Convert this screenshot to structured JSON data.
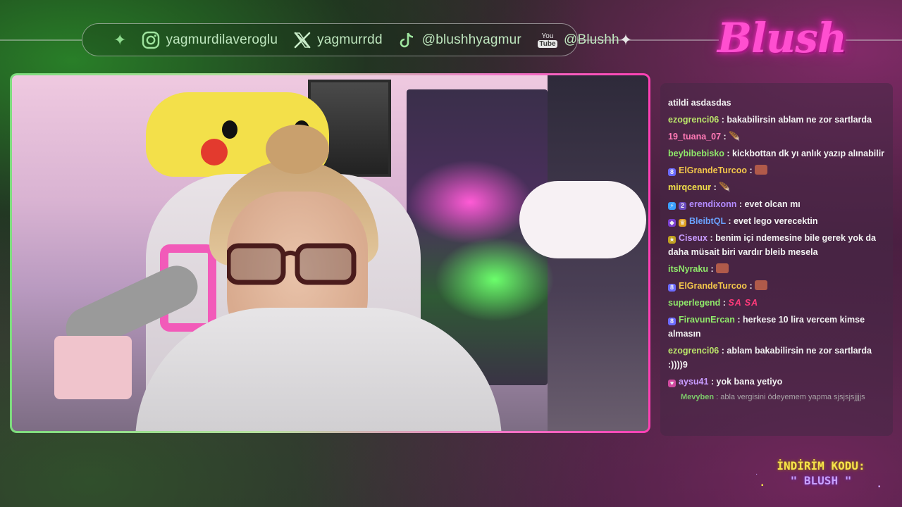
{
  "social": {
    "instagram": "yagmurdilaveroglu",
    "x": "yagmurrdd",
    "tiktok": "@blushhyagmur",
    "youtube": "@Blushh",
    "youtube_badge_top": "You",
    "youtube_badge_bottom": "Tube"
  },
  "brand": {
    "logo_text": "Blush",
    "accent_pink": "#ff4fd0",
    "accent_green": "#7ddc7d"
  },
  "chat": {
    "messages": [
      {
        "user": "",
        "user_color": "#ffffff",
        "text": "atildi asdasdas"
      },
      {
        "user": "ezogrenci06",
        "user_color": "#b9e36a",
        "text": "bakabilirsin ablam ne zor sartlarda"
      },
      {
        "user": "19_tuana_07",
        "user_color": "#ff7ab6",
        "text": ""
      },
      {
        "user": "beybibebisko",
        "user_color": "#8fe86a",
        "text": "kickbottan dk yı anlık yazıp alınabilir"
      },
      {
        "user": "ElGrandeTurcoo",
        "user_color": "#f2c64a",
        "text": ""
      },
      {
        "user": "mirqcenur",
        "user_color": "#f2e04a",
        "text": ""
      },
      {
        "user": "erendixonn",
        "user_color": "#b38cff",
        "text": "evet olcan mı"
      },
      {
        "user": "BleibtQL",
        "user_color": "#6aa2ff",
        "text": "evet lego verecektin"
      },
      {
        "user": "Ciseux",
        "user_color": "#c89cff",
        "text": "benim içi ndemesine bile gerek yok da daha müsait biri vardır bleib mesela"
      },
      {
        "user": "itsNyraku",
        "user_color": "#8fe86a",
        "text": ""
      },
      {
        "user": "ElGrandeTurcoo",
        "user_color": "#f2c64a",
        "text": ""
      },
      {
        "user": "superlegend",
        "user_color": "#8fe86a",
        "text": "SA SA"
      },
      {
        "user": "FiravunErcan",
        "user_color": "#8fe86a",
        "text": "herkese 10 lira vercem kimse almasın"
      },
      {
        "user": "ezogrenci06",
        "user_color": "#b9e36a",
        "text": "ablam bakabilirsin ne zor sartlarda :))))9"
      },
      {
        "user": "aysu41",
        "user_color": "#c89cff",
        "text": "yok bana yetiyo"
      },
      {
        "user": "Mevyben",
        "user_color": "#7cc86a",
        "text": "abla vergisini ödeyemem yapma sjsjsjsjjjjs"
      }
    ]
  },
  "promo": {
    "line1": "İNDİRİM KODU:",
    "line2": "\" BLUSH \""
  }
}
